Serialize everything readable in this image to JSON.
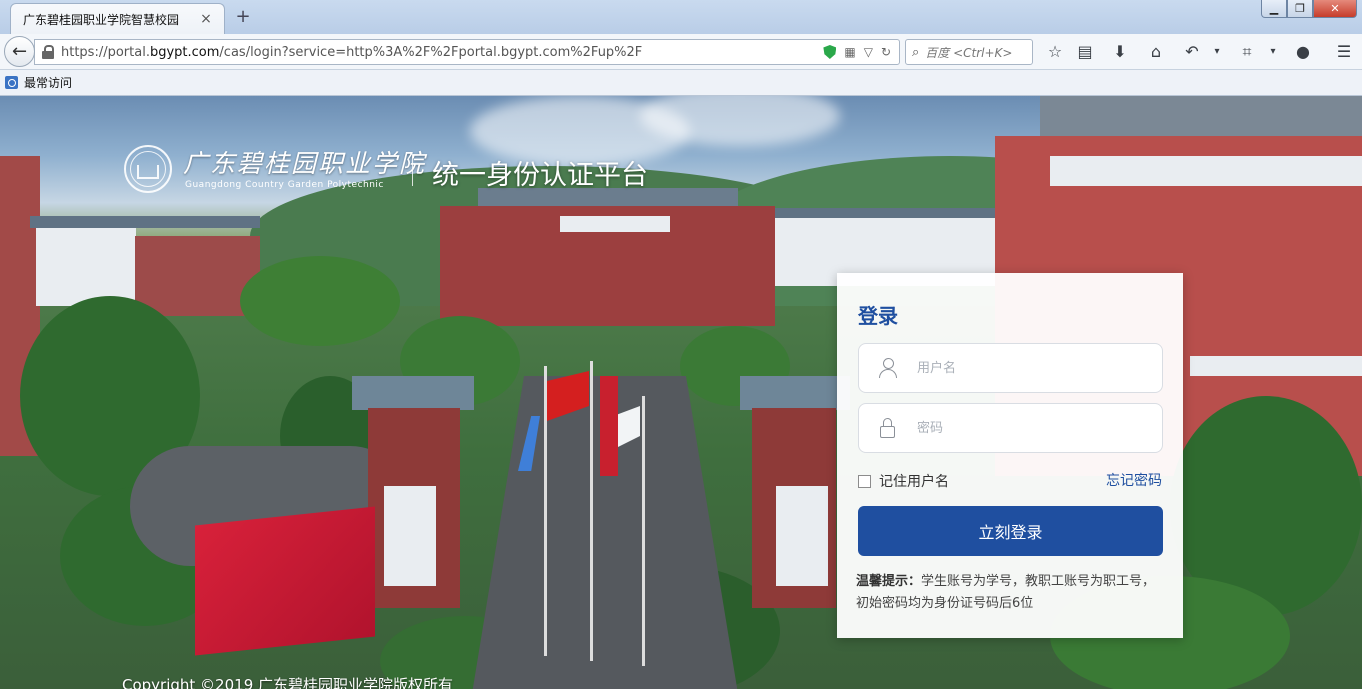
{
  "browser": {
    "tab_title": "广东碧桂园职业学院智慧校园",
    "tab_close": "×",
    "new_tab": "+",
    "url_host": "https://portal.",
    "url_domain": "bgypt.com",
    "url_path": "/cas/login?service=http%3A%2F%2Fportal.bgypt.com%2Fup%2F",
    "search_placeholder": "百度 <Ctrl+K>",
    "bookmarks_label": "最常访问"
  },
  "header": {
    "school_name_cn": "广东碧桂园职业学院",
    "school_name_en": "Guangdong Country Garden Polytechnic",
    "platform_title": "统一身份认证平台"
  },
  "login": {
    "title": "登录",
    "username_placeholder": "用户名",
    "password_placeholder": "密码",
    "remember_label": "记住用户名",
    "forgot_label": "忘记密码",
    "submit_label": "立刻登录",
    "tip_label": "温馨提示：",
    "tip_text": "学生账号为学号，教职工账号为职工号，初始密码均为身份证号码后6位"
  },
  "footer": {
    "copyright": "Copyright ©2019 广东碧桂园职业学院版权所有"
  },
  "colors": {
    "accent": "#1f4fa0",
    "chrome": "#c9daef"
  }
}
